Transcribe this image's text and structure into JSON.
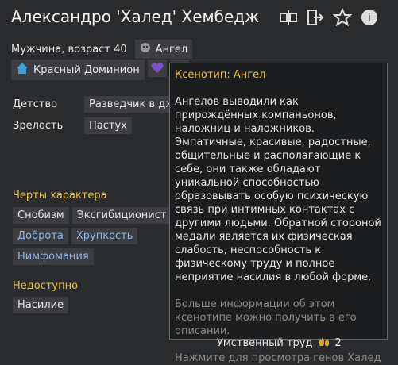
{
  "header": {
    "name": "Александро 'Халед' Хембедж"
  },
  "bio": {
    "gender_age": "Мужчина, возраст 40",
    "xenotype": "Ангел"
  },
  "faction": {
    "name": "Красный Доминион"
  },
  "backstory": {
    "childhood_label": "Детство",
    "childhood_value": "Разведчик в джу",
    "adulthood_label": "Зрелость",
    "adulthood_value": "Пастух"
  },
  "traits": {
    "title": "Черты характера",
    "items": [
      {
        "label": "Снобизм",
        "blue": false
      },
      {
        "label": "Эксгибиционист",
        "blue": false
      },
      {
        "label": "Доброта",
        "blue": true
      },
      {
        "label": "Хрупкость",
        "blue": true
      },
      {
        "label": "Нимфомания",
        "blue": true
      }
    ]
  },
  "incapable": {
    "title": "Недоступно",
    "items": [
      "Насилие"
    ]
  },
  "tooltip": {
    "title": "Ксенотип: Ангел",
    "body": "Ангелов выводили как прирождённых компаньонов, наложниц и наложников. Эмпатичные, красивые, радостные, общительные и располагающие к себе, они также обладают уникальной способностью образовывать особую психическую связь при интимных контактах с другими людьми. Обратной стороной медали является их физическая слабость, неспособность к физическому труду и полное неприятие насилия в любой форме.",
    "more": "Больше информации об этом ксенотипе можно получить в его описании.",
    "click": "Нажмите для просмотра генов Халед"
  },
  "skills": {
    "intellectual_label": "Умственный труд",
    "intellectual_value": "2"
  },
  "colors": {
    "accent": "#e8c23a",
    "bg": "#2a2b2d",
    "trait_blue": "#8ab4e8"
  }
}
